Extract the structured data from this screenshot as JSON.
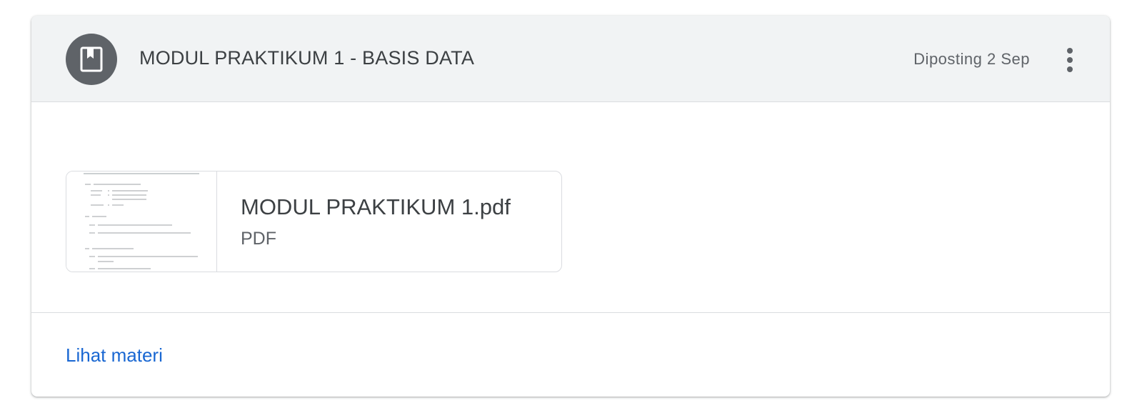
{
  "colors": {
    "header_bg": "#f1f3f4",
    "avatar_bg": "#5f6368",
    "link": "#1967d2",
    "text_primary": "#3c4043",
    "text_secondary": "#5f6368"
  },
  "header": {
    "icon": "bookmark-icon",
    "title": "MODUL PRAKTIKUM 1 - BASIS DATA",
    "posted_label": "Diposting 2 Sep",
    "more_icon": "more-vert-icon"
  },
  "attachment": {
    "file_name": "MODUL PRAKTIKUM 1.pdf",
    "file_type": "PDF",
    "thumbnail": "pdf-page-thumbnail"
  },
  "footer": {
    "view_label": "Lihat materi"
  }
}
